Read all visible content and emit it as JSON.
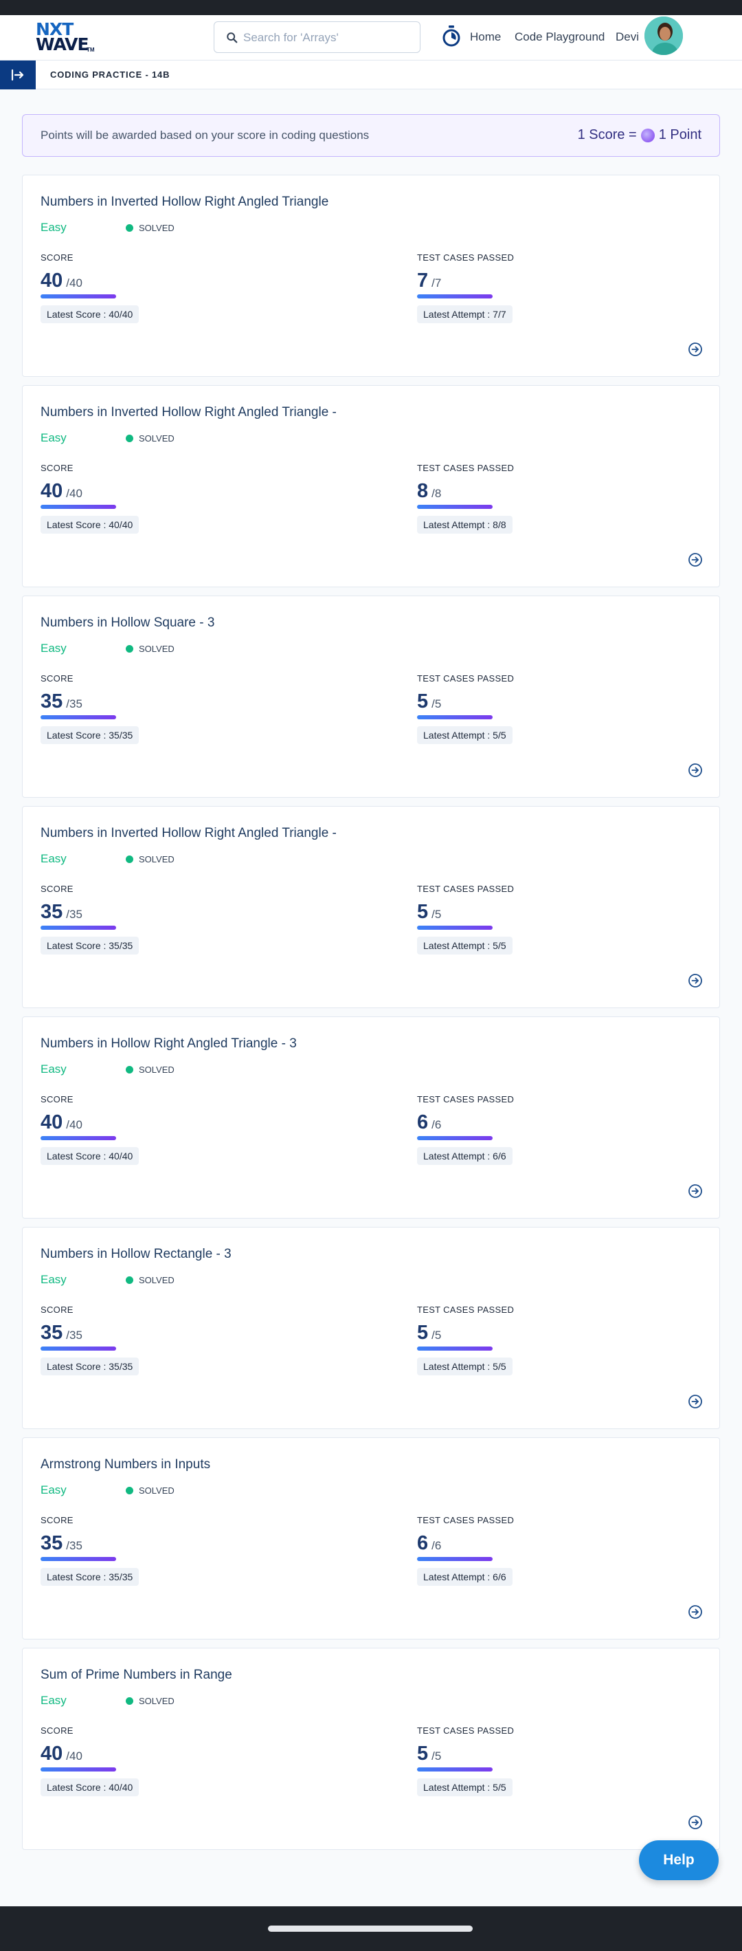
{
  "header": {
    "logo_line1": "NXT",
    "logo_line2": "WAVE",
    "logo_tm": "TM",
    "search_placeholder": "Search for 'Arrays'",
    "nav": {
      "home": "Home",
      "playground": "Code Playground",
      "user": "Devi"
    }
  },
  "subheader": {
    "breadcrumb": "CODING PRACTICE - 14B"
  },
  "banner": {
    "message": "Points will be awarded based on your score in coding questions",
    "left_text": "1 Score =",
    "right_text": "1 Point"
  },
  "labels": {
    "score": "SCORE",
    "tests": "TEST CASES PASSED"
  },
  "questions": [
    {
      "title": "Numbers in Inverted Hollow Right Angled Triangle",
      "difficulty": "Easy",
      "status": "SOLVED",
      "score": "40",
      "score_total": "/40",
      "latest_score": "Latest Score : 40/40",
      "tests": "7",
      "tests_total": "/7",
      "latest_attempt": "Latest Attempt : 7/7"
    },
    {
      "title": "Numbers in Inverted Hollow Right Angled Triangle -",
      "difficulty": "Easy",
      "status": "SOLVED",
      "score": "40",
      "score_total": "/40",
      "latest_score": "Latest Score : 40/40",
      "tests": "8",
      "tests_total": "/8",
      "latest_attempt": "Latest Attempt : 8/8"
    },
    {
      "title": "Numbers in Hollow Square - 3",
      "difficulty": "Easy",
      "status": "SOLVED",
      "score": "35",
      "score_total": "/35",
      "latest_score": "Latest Score : 35/35",
      "tests": "5",
      "tests_total": "/5",
      "latest_attempt": "Latest Attempt : 5/5"
    },
    {
      "title": "Numbers in Inverted Hollow Right Angled Triangle -",
      "difficulty": "Easy",
      "status": "SOLVED",
      "score": "35",
      "score_total": "/35",
      "latest_score": "Latest Score : 35/35",
      "tests": "5",
      "tests_total": "/5",
      "latest_attempt": "Latest Attempt : 5/5"
    },
    {
      "title": "Numbers in Hollow Right Angled Triangle - 3",
      "difficulty": "Easy",
      "status": "SOLVED",
      "score": "40",
      "score_total": "/40",
      "latest_score": "Latest Score : 40/40",
      "tests": "6",
      "tests_total": "/6",
      "latest_attempt": "Latest Attempt : 6/6"
    },
    {
      "title": "Numbers in Hollow Rectangle - 3",
      "difficulty": "Easy",
      "status": "SOLVED",
      "score": "35",
      "score_total": "/35",
      "latest_score": "Latest Score : 35/35",
      "tests": "5",
      "tests_total": "/5",
      "latest_attempt": "Latest Attempt : 5/5"
    },
    {
      "title": "Armstrong Numbers in Inputs",
      "difficulty": "Easy",
      "status": "SOLVED",
      "score": "35",
      "score_total": "/35",
      "latest_score": "Latest Score : 35/35",
      "tests": "6",
      "tests_total": "/6",
      "latest_attempt": "Latest Attempt : 6/6"
    },
    {
      "title": "Sum of Prime Numbers in Range",
      "difficulty": "Easy",
      "status": "SOLVED",
      "score": "40",
      "score_total": "/40",
      "latest_score": "Latest Score : 40/40",
      "tests": "5",
      "tests_total": "/5",
      "latest_attempt": "Latest Attempt : 5/5"
    }
  ],
  "help": {
    "label": "Help"
  },
  "colors": {
    "brand_blue": "#1565c0",
    "solved_green": "#10b981",
    "accent_purple": "#7c3aed",
    "help_blue": "#1c8adf"
  }
}
